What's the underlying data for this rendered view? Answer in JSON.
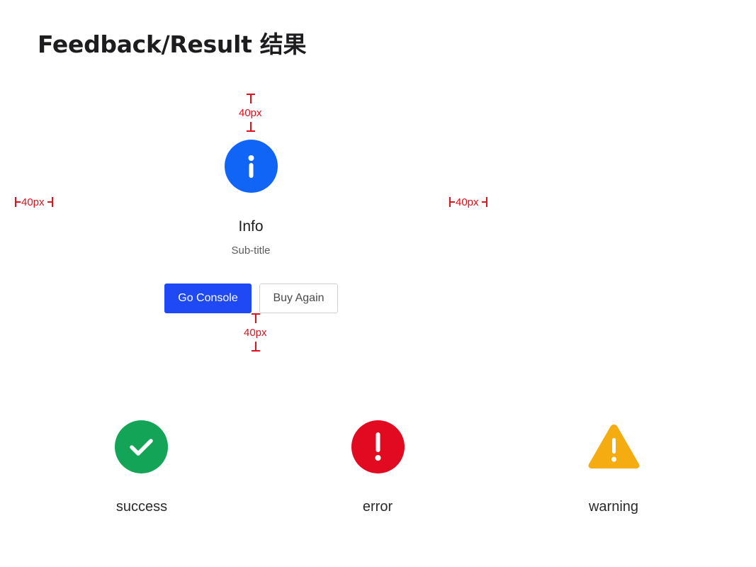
{
  "page": {
    "title": "Feedback/Result 结果"
  },
  "spec": {
    "top_gap": "40px",
    "bottom_gap": "40px",
    "left_gap": "40px",
    "right_gap": "40px",
    "color": "#e0101d"
  },
  "result": {
    "icon": "info-icon",
    "title": "Info",
    "subtitle": "Sub-title",
    "primary_button": "Go Console",
    "secondary_button": "Buy Again"
  },
  "statuses": [
    {
      "icon": "check-circle-icon",
      "label": "success",
      "color": "#14a457"
    },
    {
      "icon": "exclamation-circle-icon",
      "label": "error",
      "color": "#e10a20"
    },
    {
      "icon": "warning-triangle-icon",
      "label": "warning",
      "color": "#f5ac10"
    }
  ],
  "colors": {
    "info": "#1165f6",
    "primary_button": "#1f49f5"
  }
}
